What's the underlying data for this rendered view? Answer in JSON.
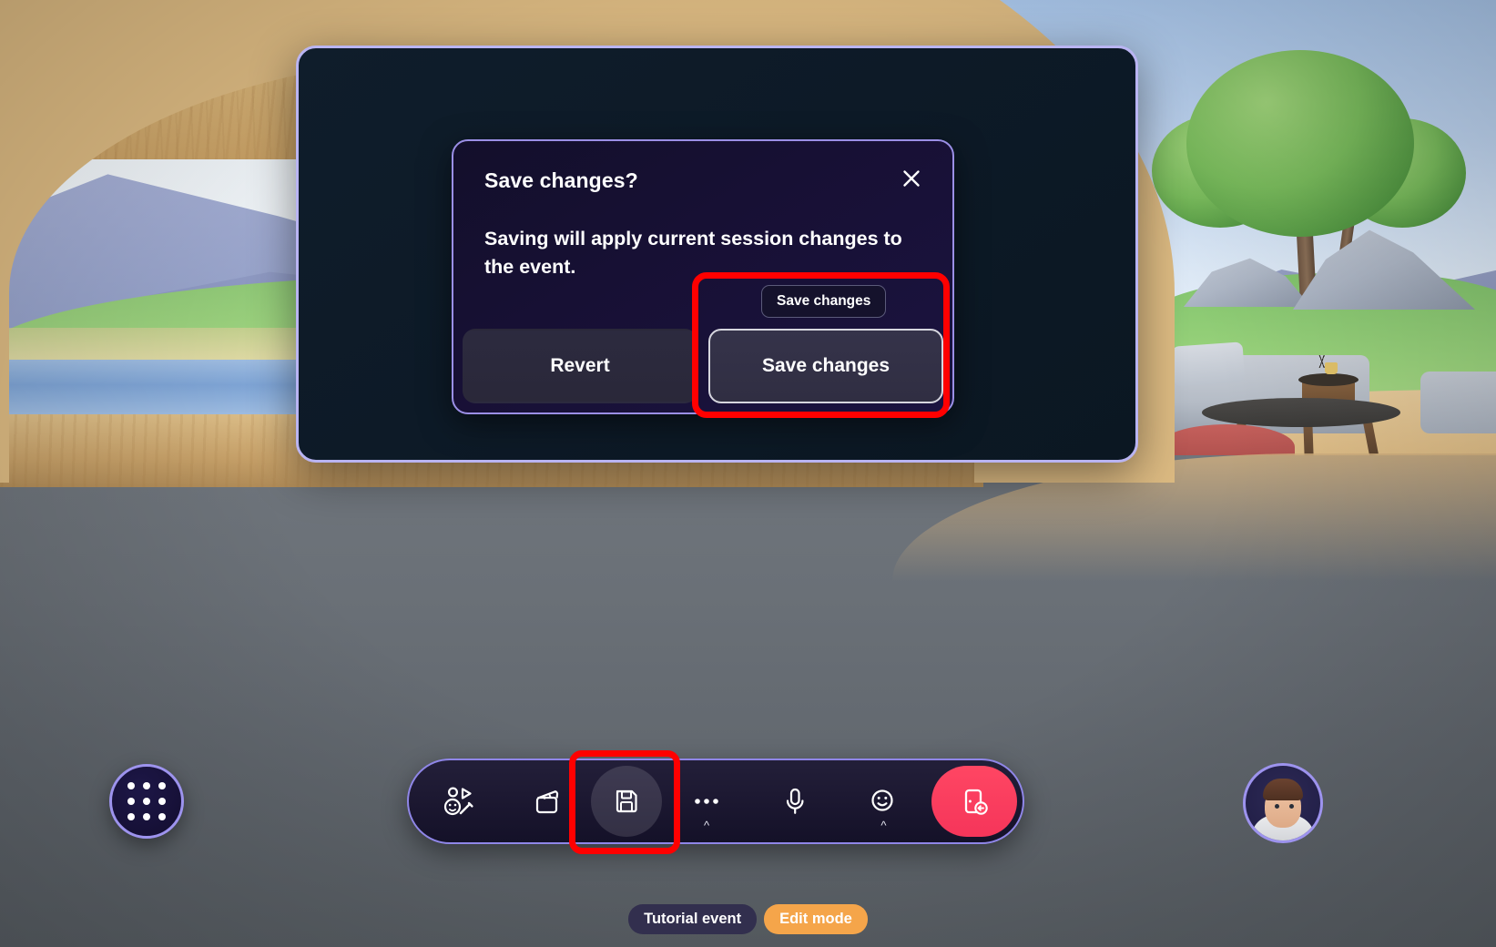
{
  "app": {
    "environment_name": "immersive-lounge-meadow"
  },
  "event_panel": {
    "name": "event-panel",
    "accent_border": "#b9b4f2",
    "background": "#0f1d2b"
  },
  "dialog": {
    "title": "Save changes?",
    "body": "Saving will apply current session changes to the event.",
    "close_label": "✕",
    "accent_border": "#9b8fe6",
    "buttons": [
      {
        "label": "Revert",
        "name": "revert-button",
        "focused": false
      },
      {
        "label": "Save changes",
        "name": "save-changes-button",
        "focused": true
      }
    ]
  },
  "tooltip": {
    "text": "Save changes"
  },
  "highlights": [
    {
      "name": "save-changes-highlight",
      "color": "#ff0000"
    },
    {
      "name": "toolbar-save-highlight",
      "color": "#ff0000"
    }
  ],
  "apps_button": {
    "label": "Apps",
    "icon": "grid-dots-icon"
  },
  "toolbar": {
    "accent_border": "#8f86e8",
    "items": [
      {
        "label": "Reactions and avatar",
        "icon": "avatar-emoji-icon",
        "active": false,
        "caret": false
      },
      {
        "label": "Scene",
        "icon": "clapperboard-icon",
        "active": false,
        "caret": false
      },
      {
        "label": "Save",
        "icon": "floppy-save-icon",
        "active": true,
        "caret": false
      },
      {
        "label": "More",
        "icon": "ellipsis-icon",
        "active": false,
        "caret": true
      },
      {
        "label": "Mic",
        "icon": "microphone-icon",
        "active": false,
        "caret": false
      },
      {
        "label": "Reactions",
        "icon": "smiley-icon",
        "active": false,
        "caret": true
      }
    ],
    "leave": {
      "label": "Leave",
      "icon": "leave-door-icon",
      "color": "#ff4663"
    }
  },
  "avatar": {
    "label": "Your avatar",
    "border_color": "#9d93ee"
  },
  "status": {
    "event_pill": "Tutorial event",
    "mode_pill": "Edit mode",
    "event_pill_color": "#322f4e",
    "mode_pill_color": "#f5a54a"
  }
}
